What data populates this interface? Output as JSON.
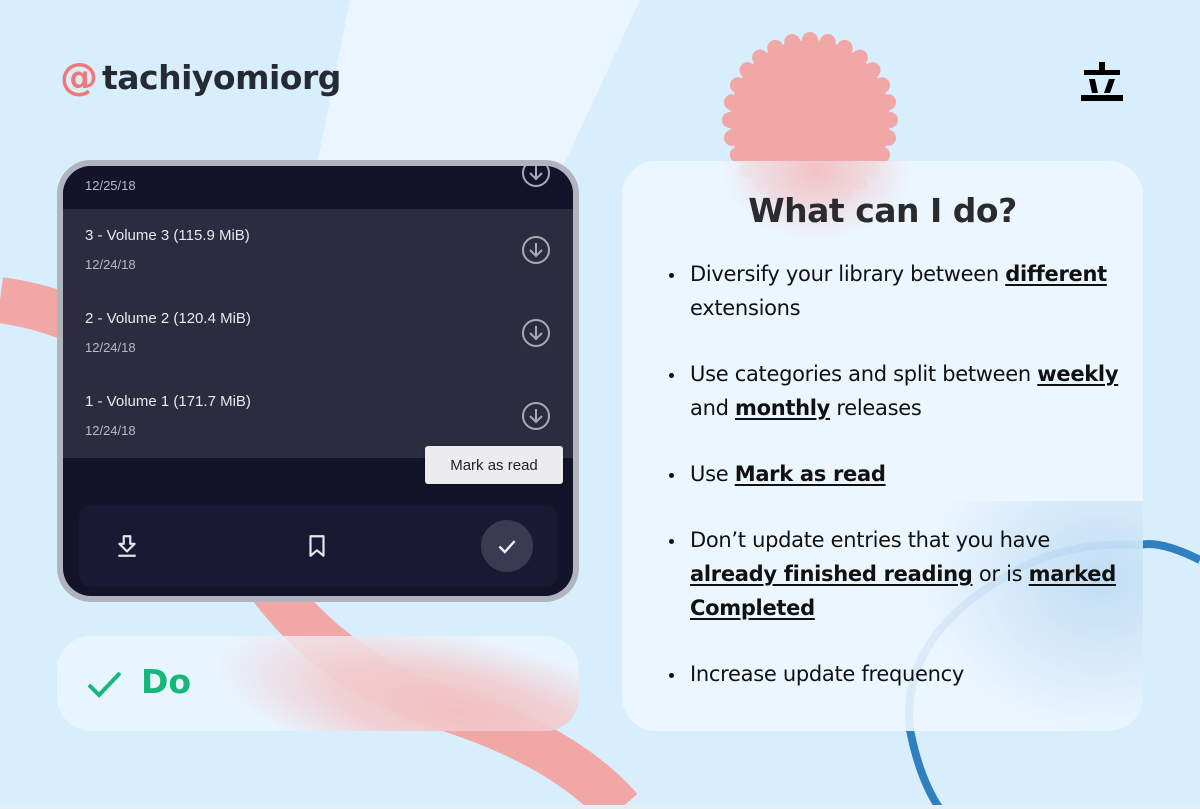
{
  "brand": {
    "at_symbol": "@",
    "handle": "tachiyomiorg",
    "logo": "tachiyomi-logo-icon"
  },
  "colors": {
    "background": "#d9eefc",
    "accent_pink": "#f2a7a7",
    "accent_blue": "#2f7fc1",
    "do_green": "#15b87a",
    "phone_bg": "#13132a",
    "list_bg": "#2b2c40"
  },
  "phone": {
    "top_row": {
      "date": "12/25/18",
      "icon": "download-circle-icon"
    },
    "chapters": [
      {
        "title": "3 - Volume 3 (115.9 MiB)",
        "date": "12/24/18",
        "icon": "download-circle-icon"
      },
      {
        "title": "2 - Volume 2 (120.4 MiB)",
        "date": "12/24/18",
        "icon": "download-circle-icon"
      },
      {
        "title": "1 - Volume 1 (171.7 MiB)",
        "date": "12/24/18",
        "icon": "download-circle-icon"
      }
    ],
    "tooltip": "Mark as read",
    "action_bar": {
      "buttons": [
        {
          "name": "download",
          "icon": "download-icon"
        },
        {
          "name": "bookmark",
          "icon": "bookmark-icon"
        },
        {
          "name": "mark-as-read",
          "icon": "check-icon"
        }
      ]
    }
  },
  "verdict": {
    "icon": "check-icon",
    "label": "Do"
  },
  "info": {
    "title": "What can I do?",
    "bullets": [
      {
        "parts": [
          {
            "text": "Diversify your library between "
          },
          {
            "text": "different",
            "emphasis": true
          },
          {
            "text": " extensions"
          }
        ]
      },
      {
        "parts": [
          {
            "text": "Use categories and split between "
          },
          {
            "text": "weekly",
            "emphasis": true
          },
          {
            "text": " and "
          },
          {
            "text": "monthly",
            "emphasis": true
          },
          {
            "text": " releases"
          }
        ]
      },
      {
        "parts": [
          {
            "text": "Use "
          },
          {
            "text": "Mark as read",
            "emphasis": true
          }
        ]
      },
      {
        "parts": [
          {
            "text": "Don’t update entries that you have "
          },
          {
            "text": "already finished reading",
            "emphasis": true
          },
          {
            "text": " or is "
          },
          {
            "text": "marked Completed",
            "emphasis": true
          }
        ]
      },
      {
        "parts": [
          {
            "text": "Increase update frequency"
          }
        ]
      }
    ]
  }
}
